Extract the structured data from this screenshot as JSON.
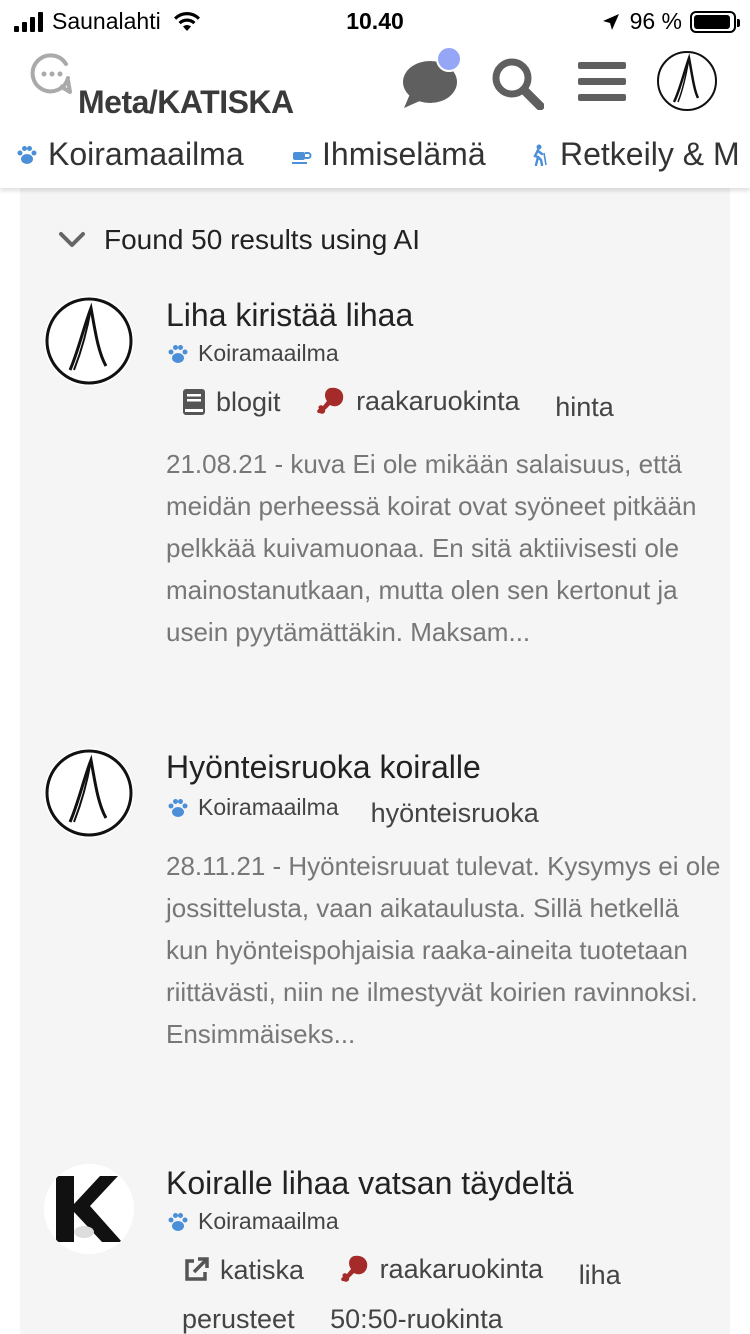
{
  "status_bar": {
    "carrier": "Saunalahti",
    "time": "10.40",
    "battery": "96 %",
    "battery_level": 0.96
  },
  "header": {
    "site_title": "Meta/KATISKA",
    "icons": [
      "chat-bubble-icon",
      "search-icon",
      "hamburger-menu-icon",
      "user-avatar"
    ],
    "notification_dot_color": "#94a6f5"
  },
  "categories": [
    {
      "label": "Koiramaailma",
      "icon": "paw-icon",
      "color": "#4a8fd8"
    },
    {
      "label": "Ihmiselämä",
      "icon": "coffee-cup-icon",
      "color": "#4a8fd8"
    },
    {
      "label": "Retkeily & M",
      "icon": "hiker-icon",
      "color": "#4a8fd8"
    }
  ],
  "search": {
    "summary": "Found 50 results using AI"
  },
  "results": [
    {
      "title": "Liha kiristää lihaa",
      "category": "Koiramaailma",
      "tags": [
        {
          "label": "blogit",
          "icon": "book-icon"
        },
        {
          "label": "raakaruokinta",
          "icon": "meat-drumstick-icon"
        },
        {
          "label": "hinta",
          "icon": ""
        }
      ],
      "date": "21.08.21",
      "excerpt": "kuva Ei ole mikään salaisuus, että meidän perheessä koirat ovat syöneet pitkään pelkkää kuivamuonaa. En sitä aktiivisesti ole mainostanutkaan, mutta olen sen kertonut ja usein pyytämättäkin. Maksam..."
    },
    {
      "title": "Hyönteisruoka koiralle",
      "category": "Koiramaailma",
      "tags": [
        {
          "label": "hyönteisruoka",
          "icon": ""
        }
      ],
      "date": "28.11.21",
      "excerpt": "Hyönteisruuat tulevat. Kysymys ei ole jossittelusta, vaan aikataulusta. Sillä hetkellä kun hyönteispohjaisia raaka-aineita tuotetaan riittävästi, niin ne ilmestyvät koirien ravinnoksi. Ensimmäiseks..."
    },
    {
      "title": "Koiralle lihaa vatsan täydeltä",
      "category": "Koiramaailma",
      "tags": [
        {
          "label": "katiska",
          "icon": "external-link-icon"
        },
        {
          "label": "raakaruokinta",
          "icon": "meat-drumstick-icon"
        },
        {
          "label": "liha",
          "icon": ""
        },
        {
          "label": "perusteet",
          "icon": ""
        },
        {
          "label": "50:50-ruokinta",
          "icon": ""
        }
      ],
      "date": "",
      "excerpt": ""
    }
  ],
  "colors": {
    "accent_blue": "#4a8fd8",
    "meat_red": "#a52a2a",
    "panel_bg": "#f5f5f5",
    "muted_text": "#777777"
  }
}
